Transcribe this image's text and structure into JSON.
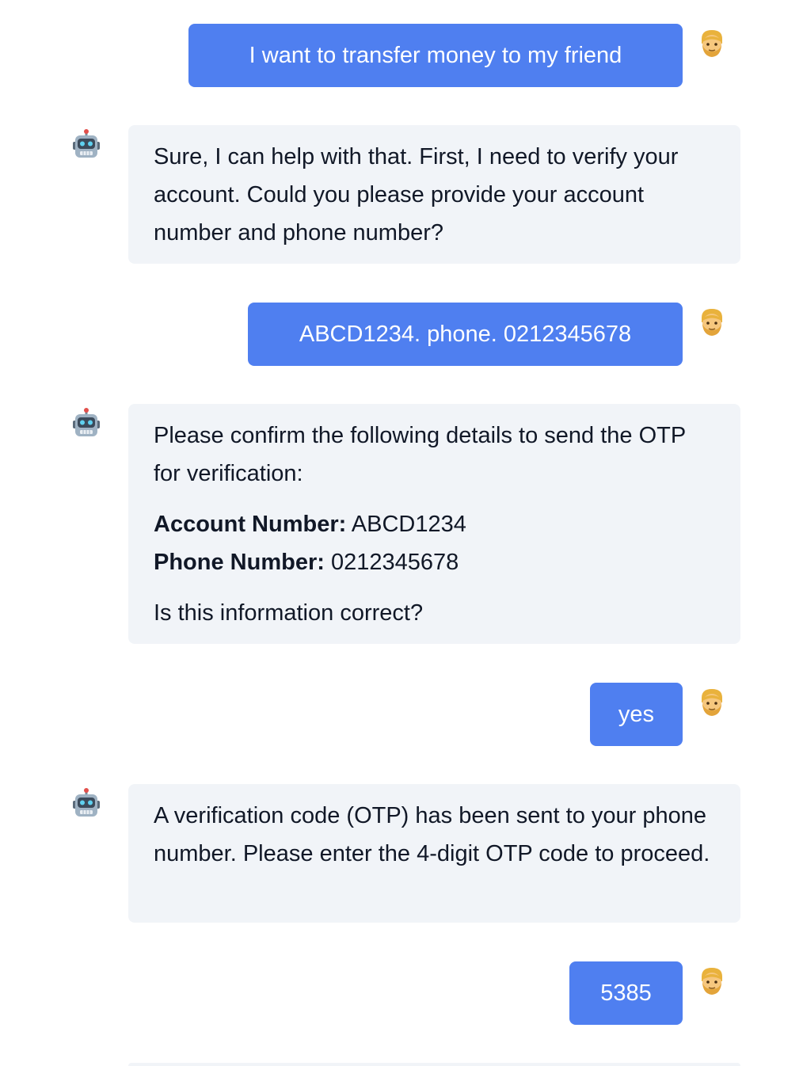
{
  "messages": [
    {
      "role": "user",
      "text": "I want to transfer money to my friend"
    },
    {
      "role": "bot",
      "lines": [
        "Sure, I can help with that. First, I need to verify your account. Could you please provide your account number and phone number?"
      ]
    },
    {
      "role": "user",
      "text": "ABCD1234. phone. 0212345678"
    },
    {
      "role": "bot",
      "intro": "Please confirm the following details to send the OTP for verification:",
      "account_label": "Account Number:",
      "account_value": "ABCD1234",
      "phone_label": "Phone Number:",
      "phone_value": "0212345678",
      "question": "Is this information correct?"
    },
    {
      "role": "user",
      "text": "yes"
    },
    {
      "role": "bot",
      "lines": [
        "A verification code (OTP) has been sent to your phone number. Please enter the 4-digit OTP code to proceed."
      ]
    },
    {
      "role": "user",
      "text": "5385"
    }
  ],
  "icons": {
    "user_avatar": "man-emoji-icon",
    "bot_avatar": "robot-emoji-icon"
  },
  "colors": {
    "user_bubble": "#4f7ff0",
    "bot_bubble": "#f1f4f8"
  }
}
